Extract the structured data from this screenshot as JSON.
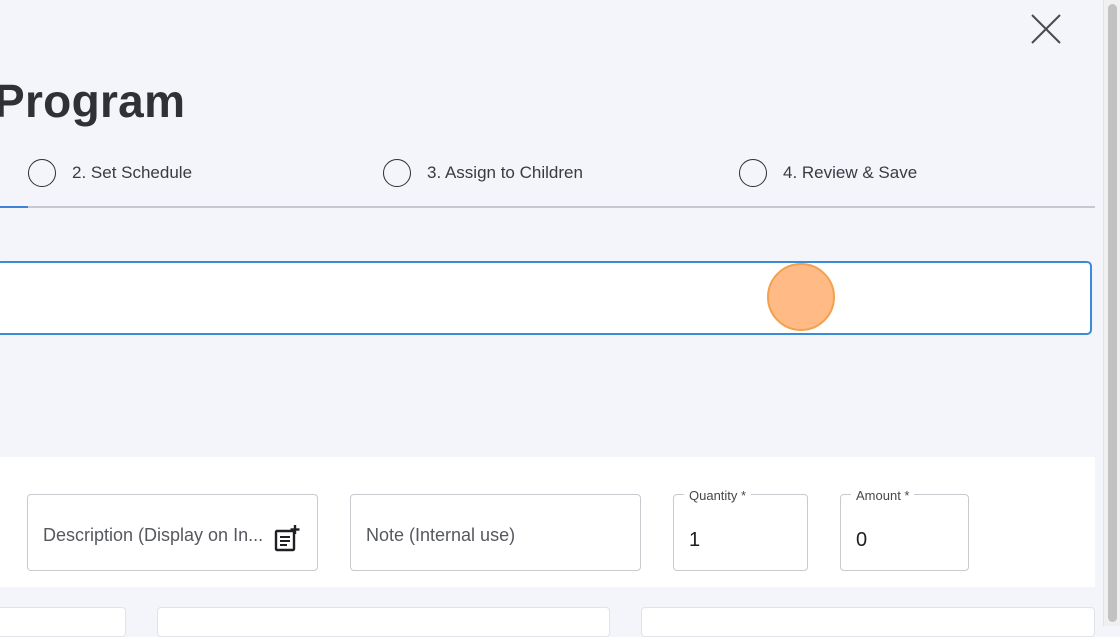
{
  "dialog": {
    "title": "Program",
    "close_icon": "close-icon"
  },
  "stepper": {
    "steps": [
      {
        "label": "2. Set Schedule",
        "completed": false
      },
      {
        "label": "3. Assign to Children",
        "completed": false
      },
      {
        "label": "4. Review & Save",
        "completed": false
      }
    ]
  },
  "name_input": {
    "value": ""
  },
  "fee_row": {
    "description": {
      "placeholder": "Description (Display on In...",
      "icon": "note-add-icon"
    },
    "note": {
      "placeholder": "Note (Internal use)"
    },
    "quantity": {
      "label": "Quantity *",
      "value": "1"
    },
    "amount": {
      "label": "Amount *",
      "value": "0"
    }
  },
  "colors": {
    "accent": "#3f83d9",
    "cursor": "#ffb278",
    "background": "#f3f5fa"
  }
}
